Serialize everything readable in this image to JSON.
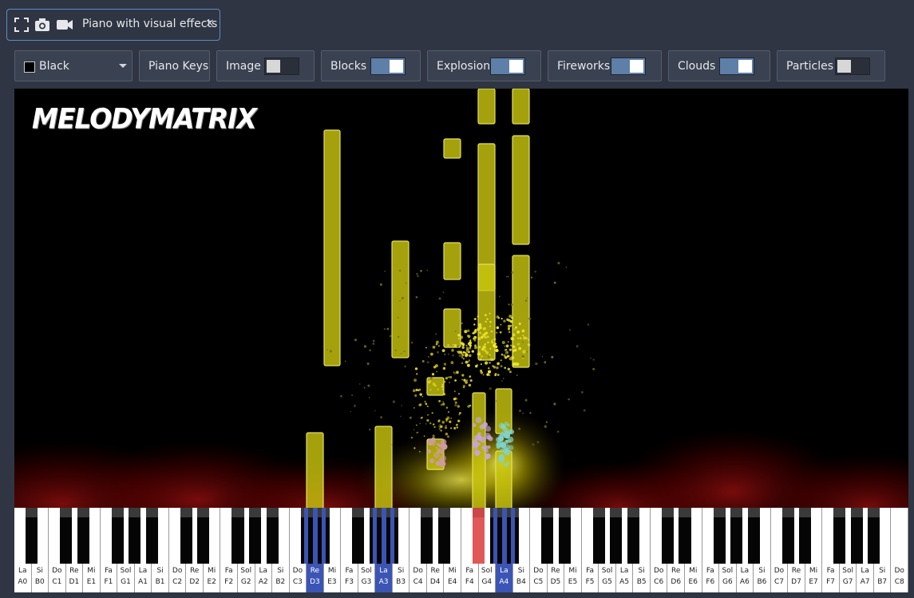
{
  "tab": {
    "title": "Piano with visual effects",
    "close": "×"
  },
  "toolbar": {
    "color_select": {
      "value": "Black",
      "swatch_color": "#000000"
    },
    "piano_keys": "Piano Keys",
    "toggles": [
      {
        "label": "Image",
        "on": false
      },
      {
        "label": "Blocks",
        "on": true
      },
      {
        "label": "Explosion",
        "on": true
      },
      {
        "label": "Fireworks",
        "on": true
      },
      {
        "label": "Clouds",
        "on": true
      },
      {
        "label": "Particles",
        "on": false
      }
    ]
  },
  "stage": {
    "logo": "MELODYMATRIX",
    "block_color": "#c8c40f"
  },
  "piano": {
    "white_keys": [
      [
        "La",
        "A0"
      ],
      [
        "Si",
        "B0"
      ],
      [
        "Do",
        "C1"
      ],
      [
        "Re",
        "D1"
      ],
      [
        "Mi",
        "E1"
      ],
      [
        "Fa",
        "F1"
      ],
      [
        "Sol",
        "G1"
      ],
      [
        "La",
        "A1"
      ],
      [
        "Si",
        "B1"
      ],
      [
        "Do",
        "C2"
      ],
      [
        "Re",
        "D2"
      ],
      [
        "Mi",
        "E2"
      ],
      [
        "Fa",
        "F2"
      ],
      [
        "Sol",
        "G2"
      ],
      [
        "La",
        "A2"
      ],
      [
        "Si",
        "B2"
      ],
      [
        "Do",
        "C3"
      ],
      [
        "Re",
        "D3"
      ],
      [
        "Mi",
        "E3"
      ],
      [
        "Fa",
        "F3"
      ],
      [
        "Sol",
        "G3"
      ],
      [
        "La",
        "A3"
      ],
      [
        "Si",
        "B3"
      ],
      [
        "Do",
        "C4"
      ],
      [
        "Re",
        "D4"
      ],
      [
        "Mi",
        "E4"
      ],
      [
        "Fa",
        "F4"
      ],
      [
        "Sol",
        "G4"
      ],
      [
        "La",
        "A4"
      ],
      [
        "Si",
        "B4"
      ],
      [
        "Do",
        "C5"
      ],
      [
        "Re",
        "D5"
      ],
      [
        "Mi",
        "E5"
      ],
      [
        "Fa",
        "F5"
      ],
      [
        "Sol",
        "G5"
      ],
      [
        "La",
        "A5"
      ],
      [
        "Si",
        "B5"
      ],
      [
        "Do",
        "C6"
      ],
      [
        "Re",
        "D6"
      ],
      [
        "Mi",
        "E6"
      ],
      [
        "Fa",
        "F6"
      ],
      [
        "Sol",
        "G6"
      ],
      [
        "La",
        "A6"
      ],
      [
        "Si",
        "B6"
      ],
      [
        "Do",
        "C7"
      ],
      [
        "Re",
        "D7"
      ],
      [
        "Mi",
        "E7"
      ],
      [
        "Fa",
        "F7"
      ],
      [
        "Sol",
        "G7"
      ],
      [
        "La",
        "A7"
      ],
      [
        "Si",
        "B7"
      ],
      [
        "Do",
        "C8"
      ]
    ],
    "active_white": [
      "D3",
      "A3",
      "A4"
    ],
    "active_color": "#3b55b5",
    "pressed_black": "F#4",
    "pressed_color": "#e05858"
  }
}
